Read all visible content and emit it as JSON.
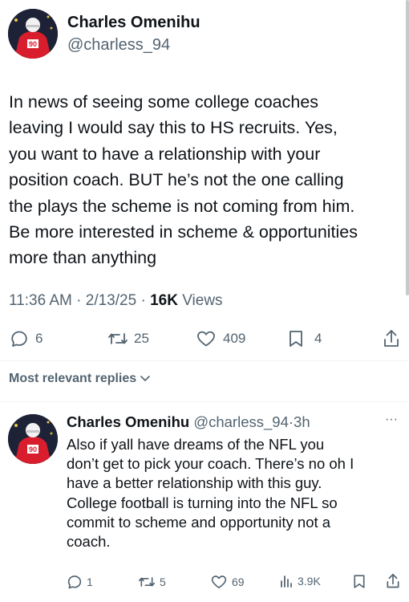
{
  "tweet": {
    "author_name": "Charles Omenihu",
    "author_handle": "@charless_94",
    "text": "In news of seeing some college coaches\nleaving I would say this to HS recruits. Yes,\nyou want to have a relationship with your\nposition coach. BUT he’s not the one calling\nthe plays the scheme is not coming from him.\nBe more interested in scheme & opportunities\nmore than anything",
    "time": "11:36 AM",
    "date": "2/13/25",
    "views_count": "16K",
    "views_label": "Views",
    "replies": "6",
    "retweets": "25",
    "likes": "409",
    "bookmarks": "4"
  },
  "sort": {
    "label": "Most relevant replies"
  },
  "reply": {
    "author_name": "Charles Omenihu",
    "author_handle": "@charless_94",
    "time_ago": "3h",
    "more": "···",
    "text": "Also if yall have dreams of the NFL you\ndon’t get to pick your coach. There’s no oh I\nhave a better relationship with this guy.\nCollege football is turning into the NFL so\ncommit to scheme and opportunity not a\ncoach.",
    "replies": "1",
    "retweets": "5",
    "likes": "69",
    "views": "3.9K"
  },
  "colors": {
    "text": "#0f1419",
    "muted": "#536471",
    "jersey": "#d81e2c"
  },
  "icons": [
    "reply-icon",
    "retweet-icon",
    "like-icon",
    "bookmark-icon",
    "share-icon",
    "views-icon",
    "chevron-down-icon",
    "more-icon"
  ]
}
